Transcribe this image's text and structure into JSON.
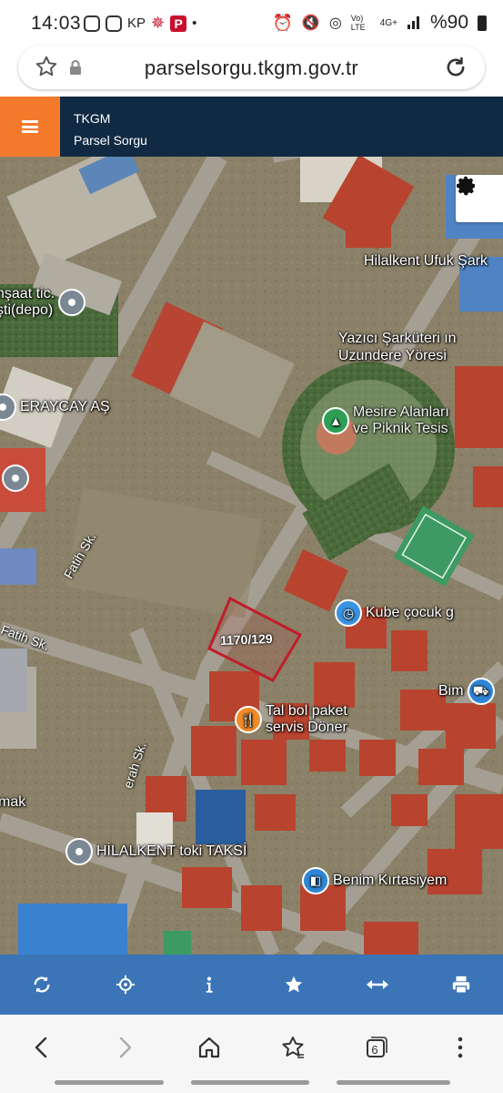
{
  "status_bar": {
    "time": "14:03",
    "left_text": "KP",
    "p_badge": "P",
    "dot": "•",
    "network": "4G+",
    "vol_lte": "Vo) LTE",
    "battery": "%90"
  },
  "url_bar": {
    "url": "parselsorgu.tkgm.gov.tr",
    "icons": [
      "star-icon",
      "lock-icon",
      "reload-icon"
    ]
  },
  "header": {
    "title": "TKGM",
    "subtitle": "Parsel Sorgu",
    "menu_icon": "hamburger-menu-icon",
    "menu_color": "#f47a2b",
    "bg_color": "#102a43"
  },
  "map": {
    "settings_icon": "gear-icon",
    "parcel": {
      "label": "1170/129",
      "outline_color": "#c01d2a"
    },
    "pois": [
      {
        "label": "nşaat tic.\nşti(depo)",
        "icon": "place-pin-icon"
      },
      {
        "label": "ERAYCAY AŞ",
        "icon": "place-pin-icon"
      },
      {
        "label": "Hilalkent Ufuk Şark",
        "icon": ""
      },
      {
        "label": "Yazıcı Şarküteri ın\nUzundere Yöresi",
        "icon": ""
      },
      {
        "label": "Mesire Alanları\nve Piknik Tesis",
        "icon": "tree-icon"
      },
      {
        "label": "Kube çocuk g",
        "icon": "store-icon"
      },
      {
        "label": "Bim",
        "icon": "cart-icon"
      },
      {
        "label": "Tal bol paket\nservis Döner",
        "icon": "restaurant-icon"
      },
      {
        "label": "HİLALKENT toki TAKSİ",
        "icon": "place-pin-icon"
      },
      {
        "label": "Benim Kırtasiyem",
        "icon": "shopping-bag-icon"
      },
      {
        "label": "mak",
        "icon": ""
      }
    ],
    "roads": [
      "Fatih Sk.",
      "Fatih Sk.",
      "erah Sk."
    ]
  },
  "toolbar": {
    "bg_color": "#3c74b8",
    "buttons": [
      {
        "name": "refresh-icon"
      },
      {
        "name": "locate-icon"
      },
      {
        "name": "info-icon"
      },
      {
        "name": "favorite-star-icon"
      },
      {
        "name": "measure-arrows-icon"
      },
      {
        "name": "print-icon"
      }
    ]
  },
  "browser_nav": {
    "tabs_count": "6",
    "buttons": [
      "back-icon",
      "forward-icon",
      "home-icon",
      "bookmark-star-icon",
      "tabs-icon",
      "more-icon"
    ]
  }
}
